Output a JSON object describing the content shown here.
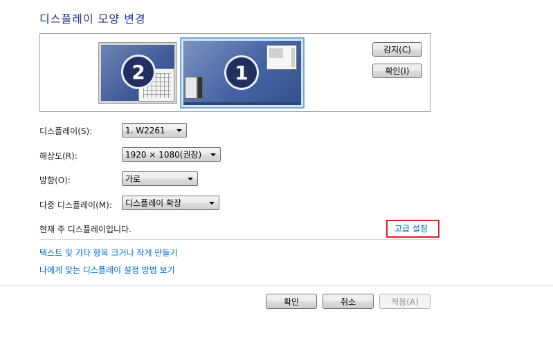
{
  "page": {
    "title": "디스플레이 모양 변경"
  },
  "preview": {
    "monitors": [
      {
        "number": "2",
        "selected": false
      },
      {
        "number": "1",
        "selected": true
      }
    ],
    "detect_button": "감지(C)",
    "identify_button": "확인(I)"
  },
  "fields": {
    "display": {
      "label": "디스플레이(S):",
      "value": "1. W2261"
    },
    "resolution": {
      "label": "해상도(R):",
      "value": "1920 × 1080(권장)"
    },
    "orientation": {
      "label": "방향(O):",
      "value": "가로"
    },
    "multiple": {
      "label": "다중 디스플레이(M):",
      "value": "디스플레이 확장"
    }
  },
  "status_text": "현재 주 디스플레이입니다.",
  "advanced_link": "고급 설정",
  "links": {
    "text_size": "텍스트 및 기타 항목 크거나 작게 만들기",
    "which_settings": "나에게 맞는 디스플레이 설정 방법 보기"
  },
  "footer": {
    "ok": "확인",
    "cancel": "취소",
    "apply": "적용(A)"
  },
  "colors": {
    "title": "#1e3287",
    "link": "#0066cc",
    "highlight": "#e01f27",
    "monitor_bg": "#4563a3"
  }
}
